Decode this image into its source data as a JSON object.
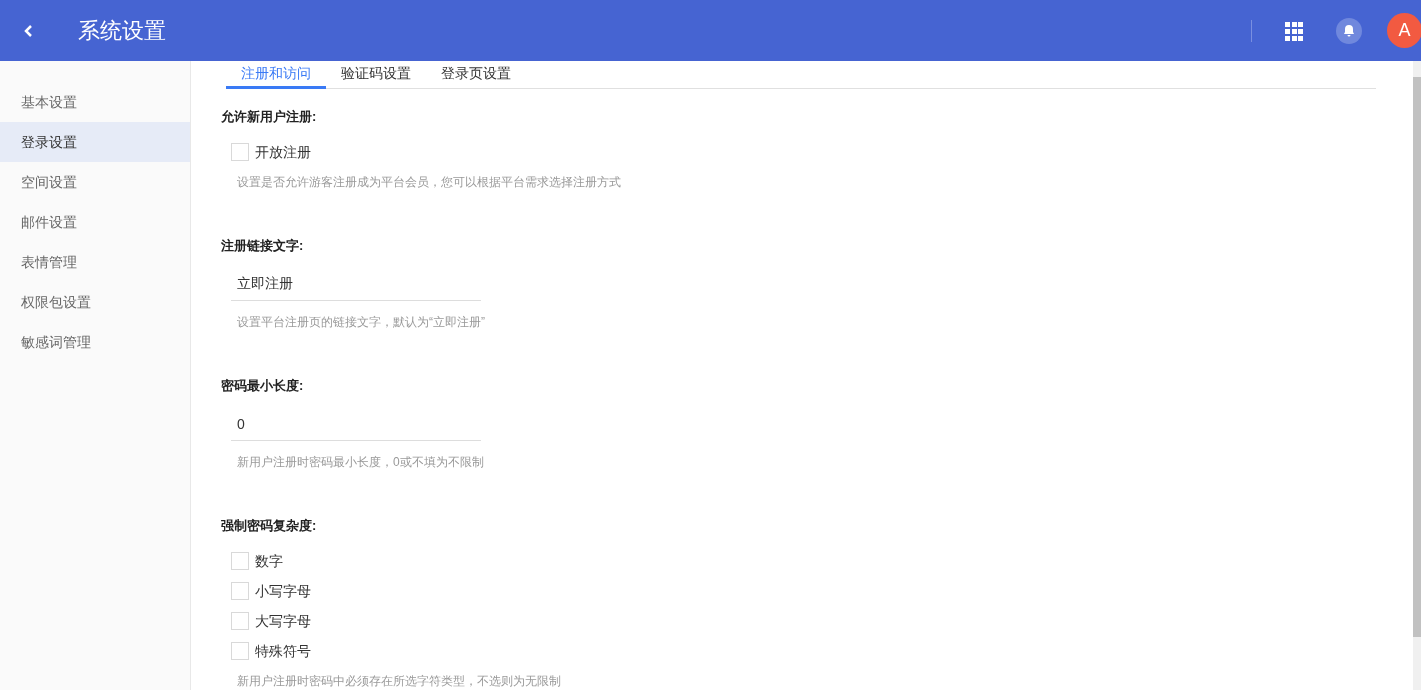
{
  "header": {
    "title": "系统设置",
    "avatar": "A"
  },
  "sidebar": {
    "items": [
      {
        "label": "基本设置",
        "selected": false
      },
      {
        "label": "登录设置",
        "selected": true
      },
      {
        "label": "空间设置",
        "selected": false
      },
      {
        "label": "邮件设置",
        "selected": false
      },
      {
        "label": "表情管理",
        "selected": false
      },
      {
        "label": "权限包设置",
        "selected": false
      },
      {
        "label": "敏感词管理",
        "selected": false
      }
    ]
  },
  "tabs": [
    {
      "label": "注册和访问",
      "selected": true
    },
    {
      "label": "验证码设置",
      "selected": false
    },
    {
      "label": "登录页设置",
      "selected": false
    }
  ],
  "sections": [
    {
      "kind": "checkboxes",
      "title": "允许新用户注册:",
      "options": [
        {
          "label": "开放注册",
          "checked": false
        }
      ],
      "hint": "设置是否允许游客注册成为平台会员，您可以根据平台需求选择注册方式"
    },
    {
      "kind": "text",
      "title": "注册链接文字:",
      "value": "立即注册",
      "hint": "设置平台注册页的链接文字，默认为“立即注册”"
    },
    {
      "kind": "text",
      "title": "密码最小长度:",
      "value": "0",
      "hint": "新用户注册时密码最小长度，0或不填为不限制"
    },
    {
      "kind": "checkboxes",
      "title": "强制密码复杂度:",
      "options": [
        {
          "label": "数字",
          "checked": false
        },
        {
          "label": "小写字母",
          "checked": false
        },
        {
          "label": "大写字母",
          "checked": false
        },
        {
          "label": "特殊符号",
          "checked": false
        }
      ],
      "hint": "新用户注册时密码中必须存在所选字符类型，不选则为无限制"
    }
  ]
}
